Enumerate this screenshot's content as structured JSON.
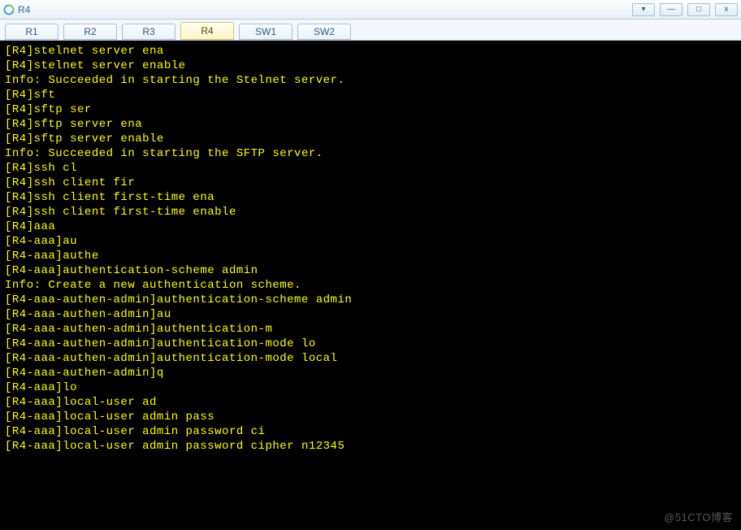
{
  "window": {
    "title": "R4",
    "buttons": {
      "dropdown": "▾",
      "minimize": "—",
      "maximize": "□",
      "close": "x"
    }
  },
  "tabs": [
    {
      "label": "R1",
      "active": false
    },
    {
      "label": "R2",
      "active": false
    },
    {
      "label": "R3",
      "active": false
    },
    {
      "label": "R4",
      "active": true
    },
    {
      "label": "SW1",
      "active": false
    },
    {
      "label": "SW2",
      "active": false
    }
  ],
  "terminal": {
    "lines": [
      "[R4]stelnet server ena",
      "[R4]stelnet server enable",
      "Info: Succeeded in starting the Stelnet server.",
      "[R4]sft",
      "[R4]sftp ser",
      "[R4]sftp server ena",
      "[R4]sftp server enable",
      "Info: Succeeded in starting the SFTP server.",
      "[R4]ssh cl",
      "[R4]ssh client fir",
      "[R4]ssh client first-time ena",
      "[R4]ssh client first-time enable",
      "[R4]aaa",
      "[R4-aaa]au",
      "[R4-aaa]authe",
      "[R4-aaa]authentication-scheme admin",
      "Info: Create a new authentication scheme.",
      "[R4-aaa-authen-admin]authentication-scheme admin",
      "[R4-aaa-authen-admin]au",
      "[R4-aaa-authen-admin]authentication-m",
      "[R4-aaa-authen-admin]authentication-mode lo",
      "[R4-aaa-authen-admin]authentication-mode local",
      "[R4-aaa-authen-admin]q",
      "[R4-aaa]lo",
      "[R4-aaa]local-user ad",
      "[R4-aaa]local-user admin pass",
      "[R4-aaa]local-user admin password ci",
      "[R4-aaa]local-user admin password cipher n12345"
    ]
  },
  "watermark": "@51CTO博客"
}
